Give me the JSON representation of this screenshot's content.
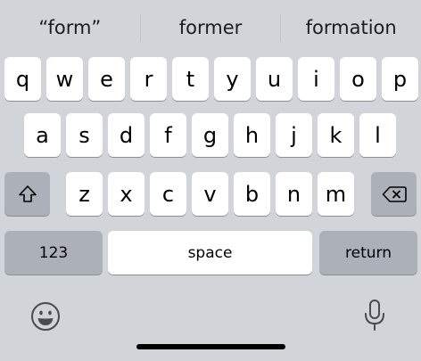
{
  "suggestions": [
    "“form”",
    "former",
    "formation"
  ],
  "rows": {
    "row1": [
      "q",
      "w",
      "e",
      "r",
      "t",
      "y",
      "u",
      "i",
      "o",
      "p"
    ],
    "row2": [
      "a",
      "s",
      "d",
      "f",
      "g",
      "h",
      "j",
      "k",
      "l"
    ],
    "row3": [
      "z",
      "x",
      "c",
      "v",
      "b",
      "n",
      "m"
    ]
  },
  "keys": {
    "numbers_label": "123",
    "space_label": "space",
    "return_label": "return"
  },
  "icons": {
    "shift": "shift-arrow-icon",
    "delete": "backspace-icon",
    "emoji": "emoji-smiley-icon",
    "dictation": "microphone-icon"
  },
  "colors": {
    "background": "#d1d4d9",
    "key_light": "#ffffff",
    "key_dark": "#acb1b9"
  }
}
